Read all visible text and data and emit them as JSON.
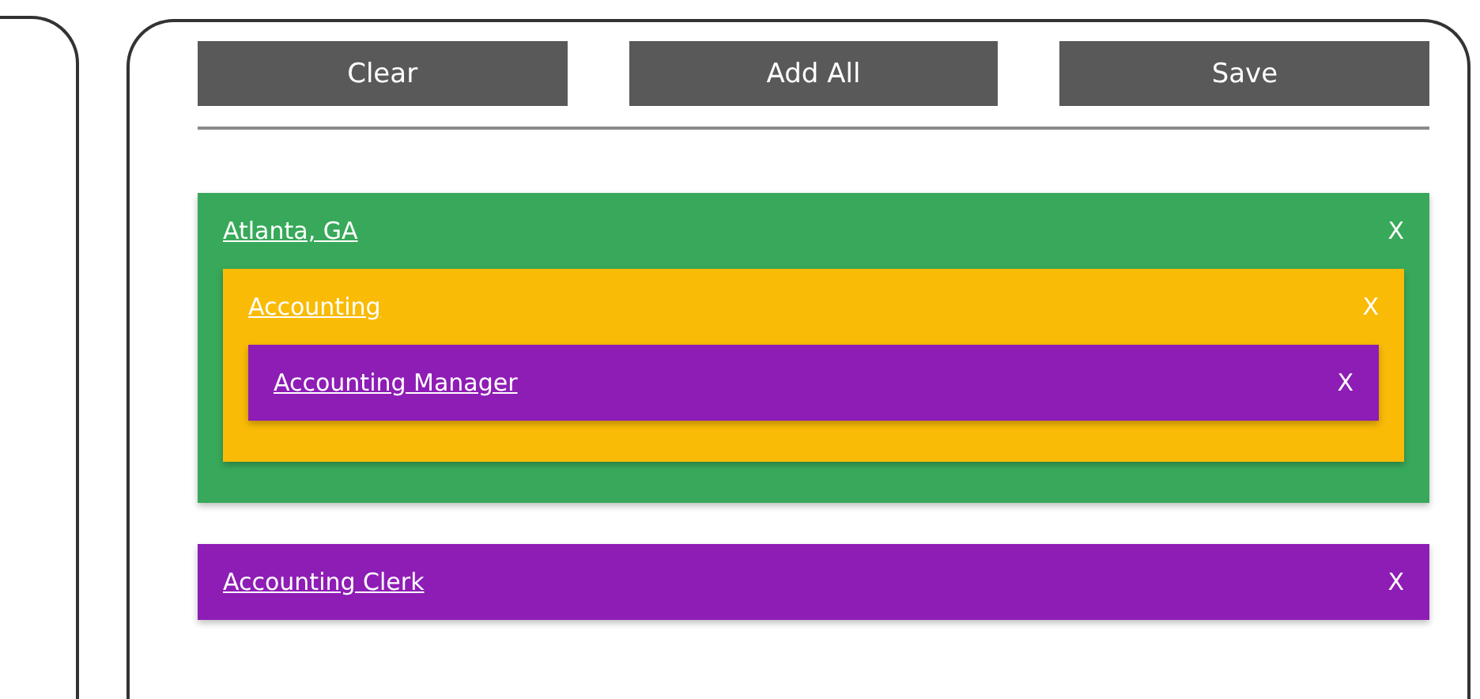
{
  "buttons": [
    {
      "label": "Clear"
    },
    {
      "label": "Add All"
    },
    {
      "label": "Save"
    }
  ],
  "items": [
    {
      "label": "Atlanta, GA",
      "remove": "X",
      "color": "#38a95a",
      "children": [
        {
          "label": "Accounting",
          "remove": "X",
          "color": "#f9bb06",
          "children": [
            {
              "label": "Accounting Manager",
              "remove": "X",
              "color": "#8e1db5"
            }
          ]
        }
      ]
    },
    {
      "label": "Accounting Clerk",
      "remove": "X",
      "color": "#8e1db5"
    }
  ]
}
